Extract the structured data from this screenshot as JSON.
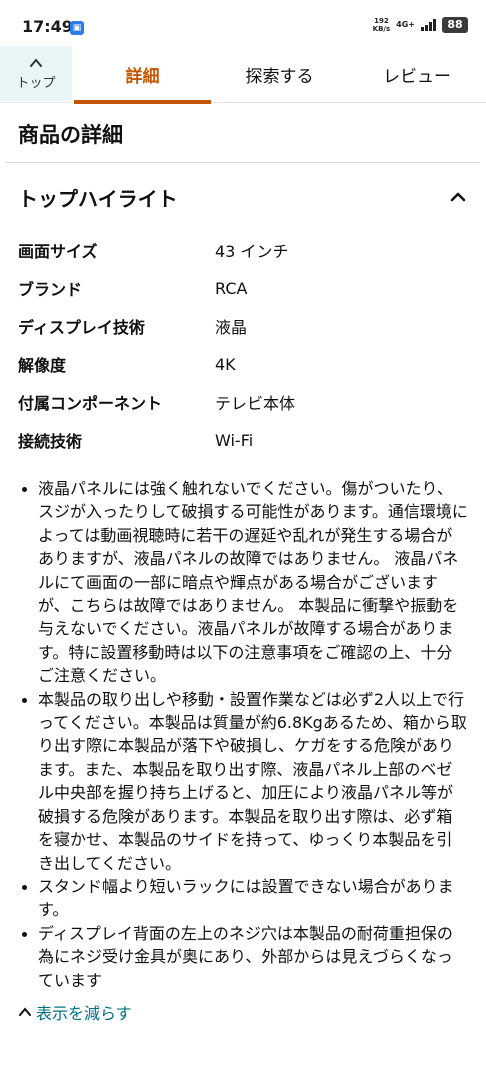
{
  "status_bar": {
    "time": "17:49",
    "net_speed_value": "192",
    "net_speed_unit": "KB/s",
    "network_type": "4G+",
    "battery": "88"
  },
  "tabs": {
    "top_label": "トップ",
    "items": [
      {
        "label": "詳細",
        "active": true
      },
      {
        "label": "探索する",
        "active": false
      },
      {
        "label": "レビュー",
        "active": false
      }
    ]
  },
  "product_details": {
    "title": "商品の詳細",
    "highlights_title": "トップハイライト",
    "specs": [
      {
        "key": "画面サイズ",
        "value": "43 インチ"
      },
      {
        "key": "ブランド",
        "value": "RCA"
      },
      {
        "key": "ディスプレイ技術",
        "value": "液晶"
      },
      {
        "key": "解像度",
        "value": "4K"
      },
      {
        "key": "付属コンポーネント",
        "value": "テレビ本体"
      },
      {
        "key": "接続技術",
        "value": "Wi-Fi"
      }
    ],
    "bullets": [
      "液晶パネルには強く触れないでください。傷がついたり、スジが入ったりして破損する可能性があります。通信環境によっては動画視聴時に若干の遅延や乱れが発生する場合がありますが、液晶パネルの故障ではありません。 液晶パネルにて画面の一部に暗点や輝点がある場合がございますが、こちらは故障ではありません。 本製品に衝撃や振動を与えないでください。液晶パネルが故障する場合があります。特に設置移動時は以下の注意事項をご確認の上、十分ご注意ください。",
      "本製品の取り出しや移動・設置作業などは必ず2人以上で行ってください。本製品は質量が約6.8Kgあるため、箱から取り出す際に本製品が落下や破損し、ケガをする危険があります。また、本製品を取り出す際、液晶パネル上部のベゼル中央部を握り持ち上げると、加圧により液晶パネル等が破損する危険があります。本製品を取り出す際は、必ず箱を寝かせ、本製品のサイドを持って、ゆっくり本製品を引き出してください。",
      "スタンド幅より短いラックには設置できない場合があります。",
      "ディスプレイ背面の左上のネジ穴は本製品の耐荷重担保の為にネジ受け金具が奥にあり、外部からは見えづらくなっています"
    ],
    "show_less_label": "表示を減らす"
  },
  "colors": {
    "accent": "#c45500",
    "link": "#007185",
    "top_button_bg": "#e8f6f7"
  }
}
